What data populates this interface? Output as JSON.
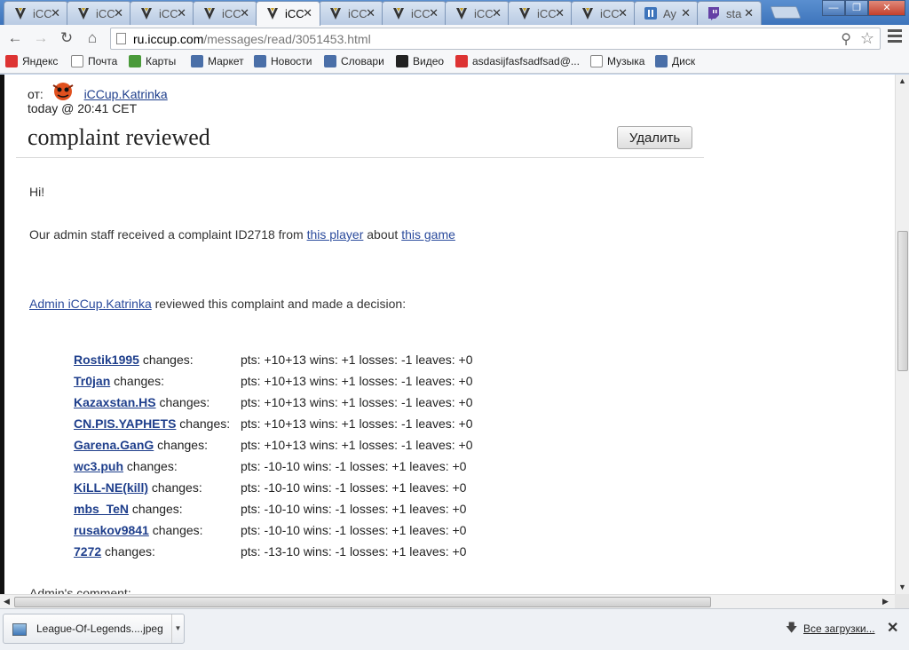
{
  "browser": {
    "tabs": [
      {
        "title": "iCC",
        "icon": "iccup-favicon",
        "active": false
      },
      {
        "title": "iCC",
        "icon": "iccup-favicon",
        "active": false
      },
      {
        "title": "iCC",
        "icon": "iccup-favicon",
        "active": false
      },
      {
        "title": "iCC",
        "icon": "iccup-favicon",
        "active": false
      },
      {
        "title": "iCC",
        "icon": "iccup-favicon",
        "active": true
      },
      {
        "title": "iCC",
        "icon": "iccup-favicon",
        "active": false
      },
      {
        "title": "iCC",
        "icon": "iccup-favicon",
        "active": false
      },
      {
        "title": "iCC",
        "icon": "iccup-favicon",
        "active": false
      },
      {
        "title": "iCC",
        "icon": "iccup-favicon",
        "active": false
      },
      {
        "title": "iCC",
        "icon": "iccup-favicon",
        "active": false
      },
      {
        "title": "Ay",
        "icon": "pause-favicon",
        "active": false
      },
      {
        "title": "sta",
        "icon": "twitch-favicon",
        "active": false
      }
    ],
    "url_host": "ru.iccup.com",
    "url_path": "/messages/read/3051453.html",
    "bookmarks": [
      {
        "label": "Яндекс",
        "icon": "yandex-icon",
        "color": "#d33"
      },
      {
        "label": "Почта",
        "icon": "page-icon",
        "color": "#fff"
      },
      {
        "label": "Карты",
        "icon": "maps-icon",
        "color": "#4a9a3a"
      },
      {
        "label": "Маркет",
        "icon": "market-icon",
        "color": "#4a6fa8"
      },
      {
        "label": "Новости",
        "icon": "news-icon",
        "color": "#4a6fa8"
      },
      {
        "label": "Словари",
        "icon": "dictionary-icon",
        "color": "#4a6fa8"
      },
      {
        "label": "Видео",
        "icon": "video-icon",
        "color": "#222"
      },
      {
        "label": "asdasijfasfsadfsad@...",
        "icon": "yandex-icon",
        "color": "#d33"
      },
      {
        "label": "Музыка",
        "icon": "page-icon",
        "color": "#fff"
      },
      {
        "label": "Диск",
        "icon": "disk-icon",
        "color": "#4a6fa8"
      }
    ]
  },
  "message": {
    "from_prefix": "от:",
    "sender": "iCCup.Katrinka",
    "timestamp": "today @ 20:41 CET",
    "subject": "complaint reviewed",
    "delete_label": "Удалить",
    "greeting": "Hi!",
    "line1_prefix": "Our admin staff received a complaint ID2718 from ",
    "line1_link1": "this player",
    "line1_mid": " about ",
    "line1_link2": "this game",
    "line2_link": "Admin iCCup.Katrinka",
    "line2_suffix": " reviewed this complaint and made a decision:",
    "changes_word": "changes:",
    "players": [
      {
        "name": "Rostik1995",
        "result": "pts: +10+13 wins: +1 losses: -1 leaves: +0"
      },
      {
        "name": "Tr0jan",
        "result": "pts: +10+13 wins: +1 losses: -1 leaves: +0"
      },
      {
        "name": "Kazaxstan.HS",
        "result": "pts: +10+13 wins: +1 losses: -1 leaves: +0"
      },
      {
        "name": "CN.PIS.YAPHETS",
        "result": "pts: +10+13 wins: +1 losses: -1 leaves: +0"
      },
      {
        "name": "Garena.GanG",
        "result": "pts: +10+13 wins: +1 losses: -1 leaves: +0"
      },
      {
        "name": "wc3.puh",
        "result": "pts: -10-10 wins: -1 losses: +1 leaves: +0"
      },
      {
        "name": "KiLL-NE(kill)",
        "result": "pts: -10-10 wins: -1 losses: +1 leaves: +0"
      },
      {
        "name": "mbs_TeN",
        "result": "pts: -10-10 wins: -1 losses: +1 leaves: +0"
      },
      {
        "name": "rusakov9841",
        "result": "pts: -10-10 wins: -1 losses: +1 leaves: +0"
      },
      {
        "name": "7272",
        "result": "pts: -13-10 wins: -1 losses: +1 leaves: +0"
      }
    ],
    "cut_text": "Admin's comment:"
  },
  "downloads": {
    "file_name": "League-Of-Legends....jpeg",
    "all_label": "Все загрузки..."
  }
}
